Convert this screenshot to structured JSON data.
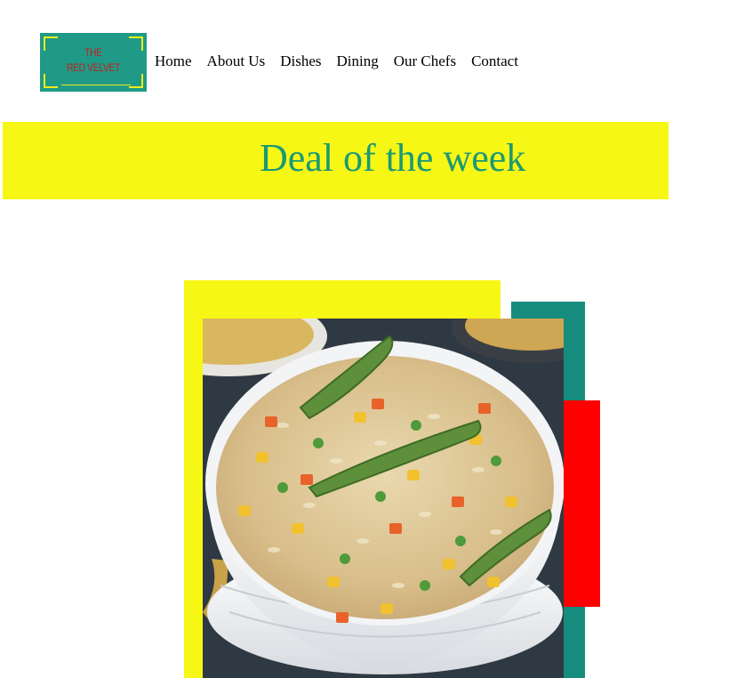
{
  "logo": {
    "line1": "THE",
    "line2": "RED VELVET",
    "colors": {
      "background": "#1f9a86",
      "frame": "#f2ec1a",
      "text": "#c41d1d"
    }
  },
  "nav": {
    "items": [
      {
        "label": "Home"
      },
      {
        "label": "About Us"
      },
      {
        "label": "Dishes"
      },
      {
        "label": "Dining"
      },
      {
        "label": "Our Chefs"
      },
      {
        "label": "Contact"
      }
    ]
  },
  "banner": {
    "title": "Deal of the week",
    "colors": {
      "background": "#f7f715",
      "text": "#1a9a73"
    }
  },
  "feature": {
    "image_subject": "bowl of vegetable fried rice",
    "colors": {
      "yellow": "#f7f715",
      "teal": "#158c7e",
      "red": "#ff0000"
    }
  }
}
